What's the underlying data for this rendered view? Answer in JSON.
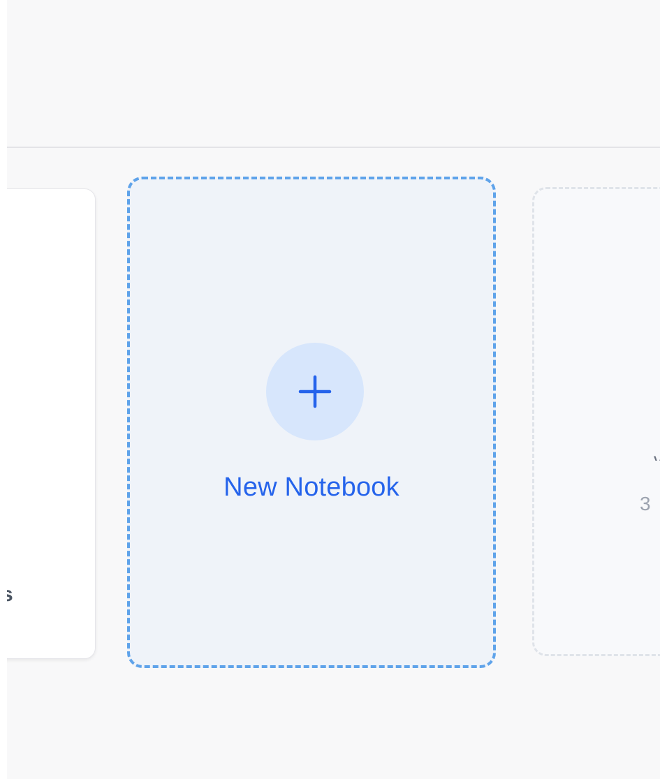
{
  "new_notebook": {
    "label": "New Notebook",
    "icon": "plus-icon",
    "accent_color": "#2563eb",
    "border_color": "#5fa3ea"
  },
  "left_card": {
    "partial_text": "s"
  },
  "right_card": {
    "partial_glyph": "v",
    "partial_count": "3"
  }
}
